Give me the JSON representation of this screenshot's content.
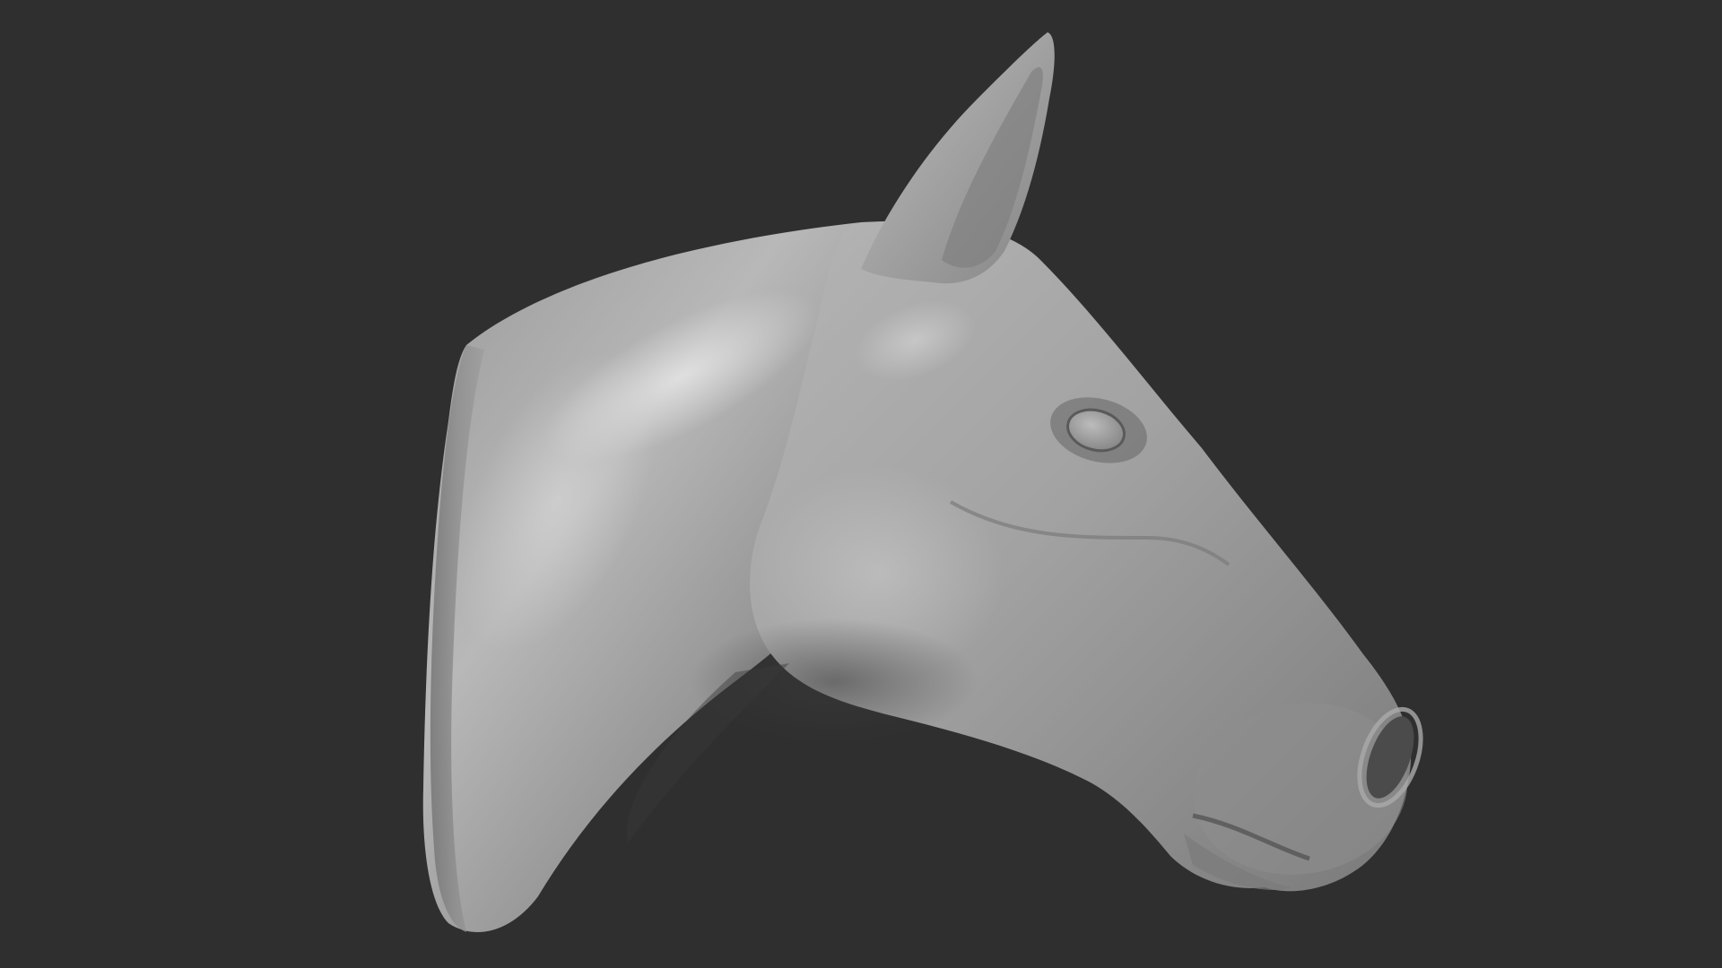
{
  "scene": {
    "subject": "horse-head-sculpt",
    "background_color": "#2f2f2f",
    "material_light": "#c9c9c9",
    "material_mid": "#8f8f8f",
    "material_dark": "#4a4a4a"
  }
}
